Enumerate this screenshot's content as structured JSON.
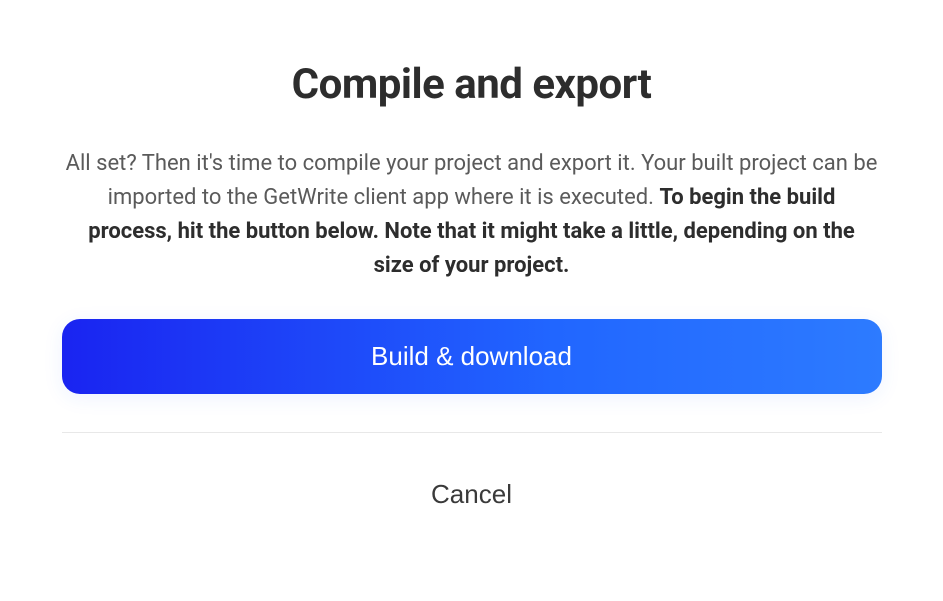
{
  "dialog": {
    "title": "Compile and export",
    "description_normal": "All set? Then it's time to compile your project and export it. Your built project can be imported to the GetWrite client app where it is executed. ",
    "description_bold": "To begin the build process, hit the button below. Note that it might take a little, depending on the size of your project.",
    "build_button_label": "Build & download",
    "cancel_button_label": "Cancel"
  }
}
